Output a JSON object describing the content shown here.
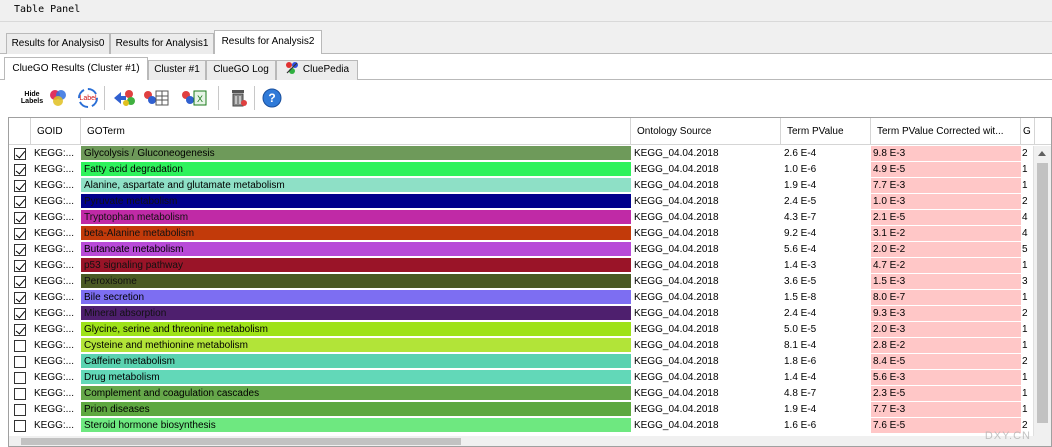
{
  "panel": {
    "title": "Table Panel"
  },
  "outer_tabs": [
    {
      "label": "Results for Analysis0",
      "active": false
    },
    {
      "label": "Results for Analysis1",
      "active": false
    },
    {
      "label": "Results for Analysis2",
      "active": true
    }
  ],
  "inner_tabs": [
    {
      "label": "ClueGO Results (Cluster #1)",
      "active": true
    },
    {
      "label": "Cluster #1",
      "active": false
    },
    {
      "label": "ClueGO Log",
      "active": false
    },
    {
      "label": "CluePedia",
      "active": false,
      "icon": "cluepedia-icon"
    }
  ],
  "toolbar": {
    "hide_labels_top": "Hide",
    "hide_labels_bottom": "Labels",
    "label_text": "Label",
    "buttons": [
      "hide-labels",
      "color-groups",
      "label-toggle",
      "send-to-cytoscape",
      "export-table",
      "export-excel",
      "delete",
      "help"
    ]
  },
  "table": {
    "columns": [
      "GOID",
      "GOTerm",
      "Ontology Source",
      "Term PValue",
      "Term PValue Corrected wit...",
      "G"
    ],
    "rows": [
      {
        "checked": true,
        "goid": "KEGG:...",
        "term": "Glycolysis / Gluconeogenesis",
        "color": "#6e9a5a",
        "source": "KEGG_04.04.2018",
        "pval": "2.6 E-4",
        "pcorr": "9.8 E-3",
        "extra": "2"
      },
      {
        "checked": true,
        "goid": "KEGG:...",
        "term": "Fatty acid degradation",
        "color": "#2ef25c",
        "source": "KEGG_04.04.2018",
        "pval": "1.0 E-6",
        "pcorr": "4.9 E-5",
        "extra": "1"
      },
      {
        "checked": true,
        "goid": "KEGG:...",
        "term": "Alanine, aspartate and glutamate metabolism",
        "color": "#8ee0c6",
        "source": "KEGG_04.04.2018",
        "pval": "1.9 E-4",
        "pcorr": "7.7 E-3",
        "extra": "1"
      },
      {
        "checked": true,
        "goid": "KEGG:...",
        "term": "Pyruvate metabolism",
        "color": "#00008b",
        "source": "KEGG_04.04.2018",
        "pval": "2.4 E-5",
        "pcorr": "1.0 E-3",
        "extra": "2"
      },
      {
        "checked": true,
        "goid": "KEGG:...",
        "term": "Tryptophan metabolism",
        "color": "#c02aa6",
        "source": "KEGG_04.04.2018",
        "pval": "4.3 E-7",
        "pcorr": "2.1 E-5",
        "extra": "4"
      },
      {
        "checked": true,
        "goid": "KEGG:...",
        "term": "beta-Alanine metabolism",
        "color": "#c23a0a",
        "source": "KEGG_04.04.2018",
        "pval": "9.2 E-4",
        "pcorr": "3.1 E-2",
        "extra": "4"
      },
      {
        "checked": true,
        "goid": "KEGG:...",
        "term": "Butanoate metabolism",
        "color": "#b84ad8",
        "source": "KEGG_04.04.2018",
        "pval": "5.6 E-4",
        "pcorr": "2.0 E-2",
        "extra": "5"
      },
      {
        "checked": true,
        "goid": "KEGG:...",
        "term": "p53 signaling pathway",
        "color": "#9a1428",
        "source": "KEGG_04.04.2018",
        "pval": "1.4 E-3",
        "pcorr": "4.7 E-2",
        "extra": "1"
      },
      {
        "checked": true,
        "goid": "KEGG:...",
        "term": "Peroxisome",
        "color": "#4a5a24",
        "source": "KEGG_04.04.2018",
        "pval": "3.6 E-5",
        "pcorr": "1.5 E-3",
        "extra": "3"
      },
      {
        "checked": true,
        "goid": "KEGG:...",
        "term": "Bile secretion",
        "color": "#7d6ef2",
        "source": "KEGG_04.04.2018",
        "pval": "1.5 E-8",
        "pcorr": "8.0 E-7",
        "extra": "1"
      },
      {
        "checked": true,
        "goid": "KEGG:...",
        "term": "Mineral absorption",
        "color": "#4e1f6e",
        "source": "KEGG_04.04.2018",
        "pval": "2.4 E-4",
        "pcorr": "9.3 E-3",
        "extra": "2"
      },
      {
        "checked": true,
        "goid": "KEGG:...",
        "term": "Glycine, serine and threonine metabolism",
        "color": "#9ee218",
        "source": "KEGG_04.04.2018",
        "pval": "5.0 E-5",
        "pcorr": "2.0 E-3",
        "extra": "1"
      },
      {
        "checked": false,
        "goid": "KEGG:...",
        "term": "Cysteine and methionine metabolism",
        "color": "#b2e438",
        "source": "KEGG_04.04.2018",
        "pval": "8.1 E-4",
        "pcorr": "2.8 E-2",
        "extra": "1"
      },
      {
        "checked": false,
        "goid": "KEGG:...",
        "term": "Caffeine metabolism",
        "color": "#5ad2b0",
        "source": "KEGG_04.04.2018",
        "pval": "1.8 E-6",
        "pcorr": "8.4 E-5",
        "extra": "2"
      },
      {
        "checked": false,
        "goid": "KEGG:...",
        "term": "Drug metabolism",
        "color": "#62d8b8",
        "source": "KEGG_04.04.2018",
        "pval": "1.4 E-4",
        "pcorr": "5.6 E-3",
        "extra": "1"
      },
      {
        "checked": false,
        "goid": "KEGG:...",
        "term": "Complement and coagulation cascades",
        "color": "#66a84a",
        "source": "KEGG_04.04.2018",
        "pval": "4.8 E-7",
        "pcorr": "2.3 E-5",
        "extra": "1"
      },
      {
        "checked": false,
        "goid": "KEGG:...",
        "term": "Prion diseases",
        "color": "#5ea840",
        "source": "KEGG_04.04.2018",
        "pval": "1.9 E-4",
        "pcorr": "7.7 E-3",
        "extra": "1"
      },
      {
        "checked": false,
        "goid": "KEGG:...",
        "term": "Steroid hormone biosynthesis",
        "color": "#6ee880",
        "source": "KEGG_04.04.2018",
        "pval": "1.6 E-6",
        "pcorr": "7.6 E-5",
        "extra": "2"
      }
    ]
  },
  "watermark": "DXY.CN"
}
